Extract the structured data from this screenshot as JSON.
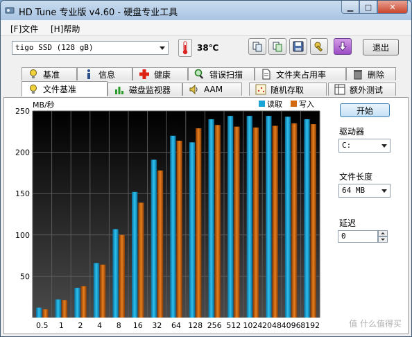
{
  "window": {
    "title": "HD Tune 专业版 v4.60 - 硬盘专业工具"
  },
  "menu": {
    "file": "[F]文件",
    "help": "[H]帮助"
  },
  "toolbar": {
    "drive_select": "tigo SSD (128 gB)",
    "temperature": "38℃",
    "exit_label": "退出"
  },
  "tabs_row1": [
    "基准",
    "信息",
    "健康",
    "错误扫描",
    "文件夹占用率",
    "删除"
  ],
  "tabs_row2": [
    "文件基准",
    "磁盘监视器",
    "AAM",
    "随机存取",
    "额外测试"
  ],
  "side": {
    "start_label": "开始",
    "drive_label": "驱动器",
    "drive_value": "C:",
    "file_length_label": "文件长度",
    "file_length_value": "64 MB",
    "delay_label": "延迟",
    "delay_value": "0"
  },
  "watermark": "值 什么值得买",
  "colors": {
    "read": "#1aa4d6",
    "write": "#d26a10"
  },
  "chart_data": {
    "type": "bar",
    "ylabel": "MB/秒",
    "categories": [
      "0.5",
      "1",
      "2",
      "4",
      "8",
      "16",
      "32",
      "64",
      "128",
      "256",
      "512",
      "1024",
      "2048",
      "4096",
      "8192"
    ],
    "yticks": [
      50,
      100,
      150,
      200,
      250
    ],
    "ylim": [
      0,
      250
    ],
    "grid": true,
    "legend": "top-right",
    "series": [
      {
        "name": "读取",
        "values": [
          12,
          22,
          36,
          66,
          107,
          152,
          191,
          220,
          212,
          240,
          244,
          244,
          244,
          243,
          240
        ]
      },
      {
        "name": "写入",
        "values": [
          10,
          21,
          38,
          64,
          100,
          139,
          178,
          214,
          229,
          233,
          231,
          230,
          232,
          235,
          234
        ]
      }
    ]
  }
}
